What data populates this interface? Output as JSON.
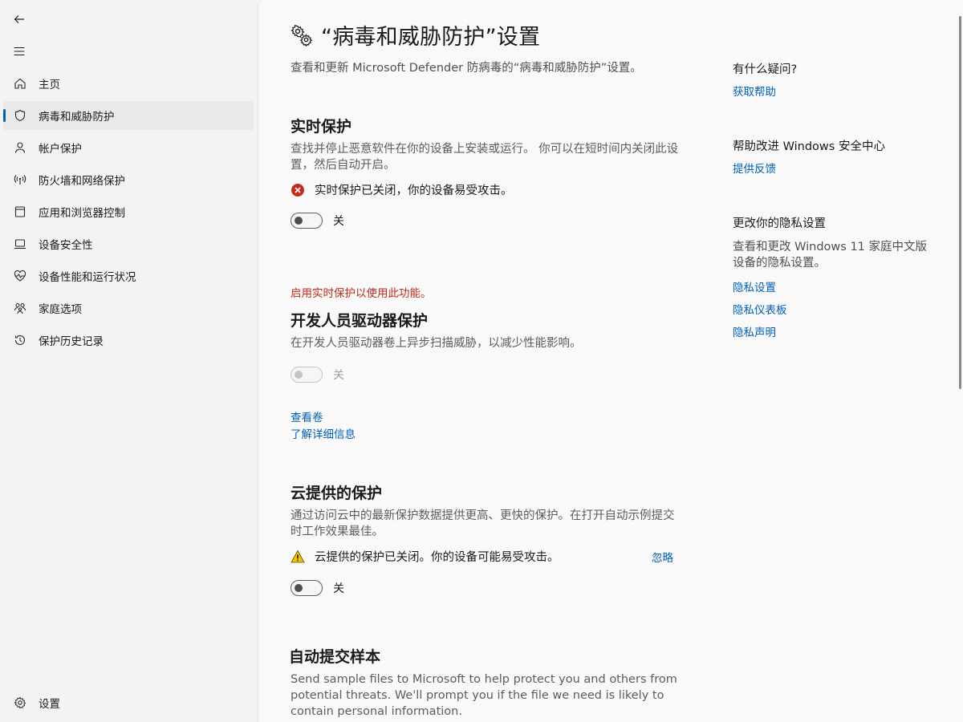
{
  "sidebar": {
    "back_icon": "back-arrow-icon",
    "menu_icon": "hamburger-menu-icon",
    "items": [
      {
        "label": "主页",
        "icon": "home-icon"
      },
      {
        "label": "病毒和威胁防护",
        "icon": "shield-icon",
        "selected": true
      },
      {
        "label": "帐户保护",
        "icon": "person-icon"
      },
      {
        "label": "防火墙和网络保护",
        "icon": "wifi-broadcast-icon"
      },
      {
        "label": "应用和浏览器控制",
        "icon": "app-window-icon"
      },
      {
        "label": "设备安全性",
        "icon": "laptop-icon"
      },
      {
        "label": "设备性能和运行状况",
        "icon": "heart-pulse-icon"
      },
      {
        "label": "家庭选项",
        "icon": "family-icon"
      },
      {
        "label": "保护历史记录",
        "icon": "history-icon"
      }
    ],
    "settings": {
      "label": "设置",
      "icon": "gear-icon"
    }
  },
  "header": {
    "title": "“病毒和威胁防护”设置",
    "title_icon": "gears-icon",
    "subtitle": "查看和更新 Microsoft Defender 防病毒的“病毒和威胁防护”设置。"
  },
  "realtime": {
    "title": "实时保护",
    "desc": "查找并停止恶意软件在你的设备上安装或运行。 你可以在短时间内关闭此设置，然后自动开启。",
    "status": "实时保护已关闭，你的设备易受攻击。",
    "status_icon": "error-circle-icon",
    "toggle_label": "关",
    "toggle_on": false
  },
  "devdrive": {
    "warning": "启用实时保护以使用此功能。",
    "title": "开发人员驱动器保护",
    "desc": "在开发人员驱动器卷上异步扫描威胁，以减少性能影响。",
    "toggle_label": "关",
    "toggle_on": false,
    "toggle_disabled": true,
    "link_view": "查看卷",
    "link_learn": "了解详细信息"
  },
  "cloud": {
    "title": "云提供的保护",
    "desc": "通过访问云中的最新保护数据提供更高、更快的保护。在打开自动示例提交时工作效果最佳。",
    "status": "云提供的保护已关闭。你的设备可能易受攻击。",
    "status_icon": "warning-triangle-icon",
    "dismiss": "忽略",
    "toggle_label": "关",
    "toggle_on": false
  },
  "sample": {
    "title": "自动提交样本",
    "desc": "Send sample files to Microsoft to help protect you and others from potential threats. We'll prompt you if the file we need is likely to contain personal information."
  },
  "right": {
    "q_title": "有什么疑问?",
    "get_help": "获取帮助",
    "improve_title": "帮助改进 Windows 安全中心",
    "feedback": "提供反馈",
    "privacy_title": "更改你的隐私设置",
    "privacy_desc": "查看和更改 Windows 11 家庭中文版设备的隐私设置。",
    "privacy_settings": "隐私设置",
    "privacy_dashboard": "隐私仪表板",
    "privacy_statement": "隐私声明"
  },
  "colors": {
    "accent": "#005fb8",
    "error": "#c42b1c",
    "warning": "#f7c400"
  }
}
